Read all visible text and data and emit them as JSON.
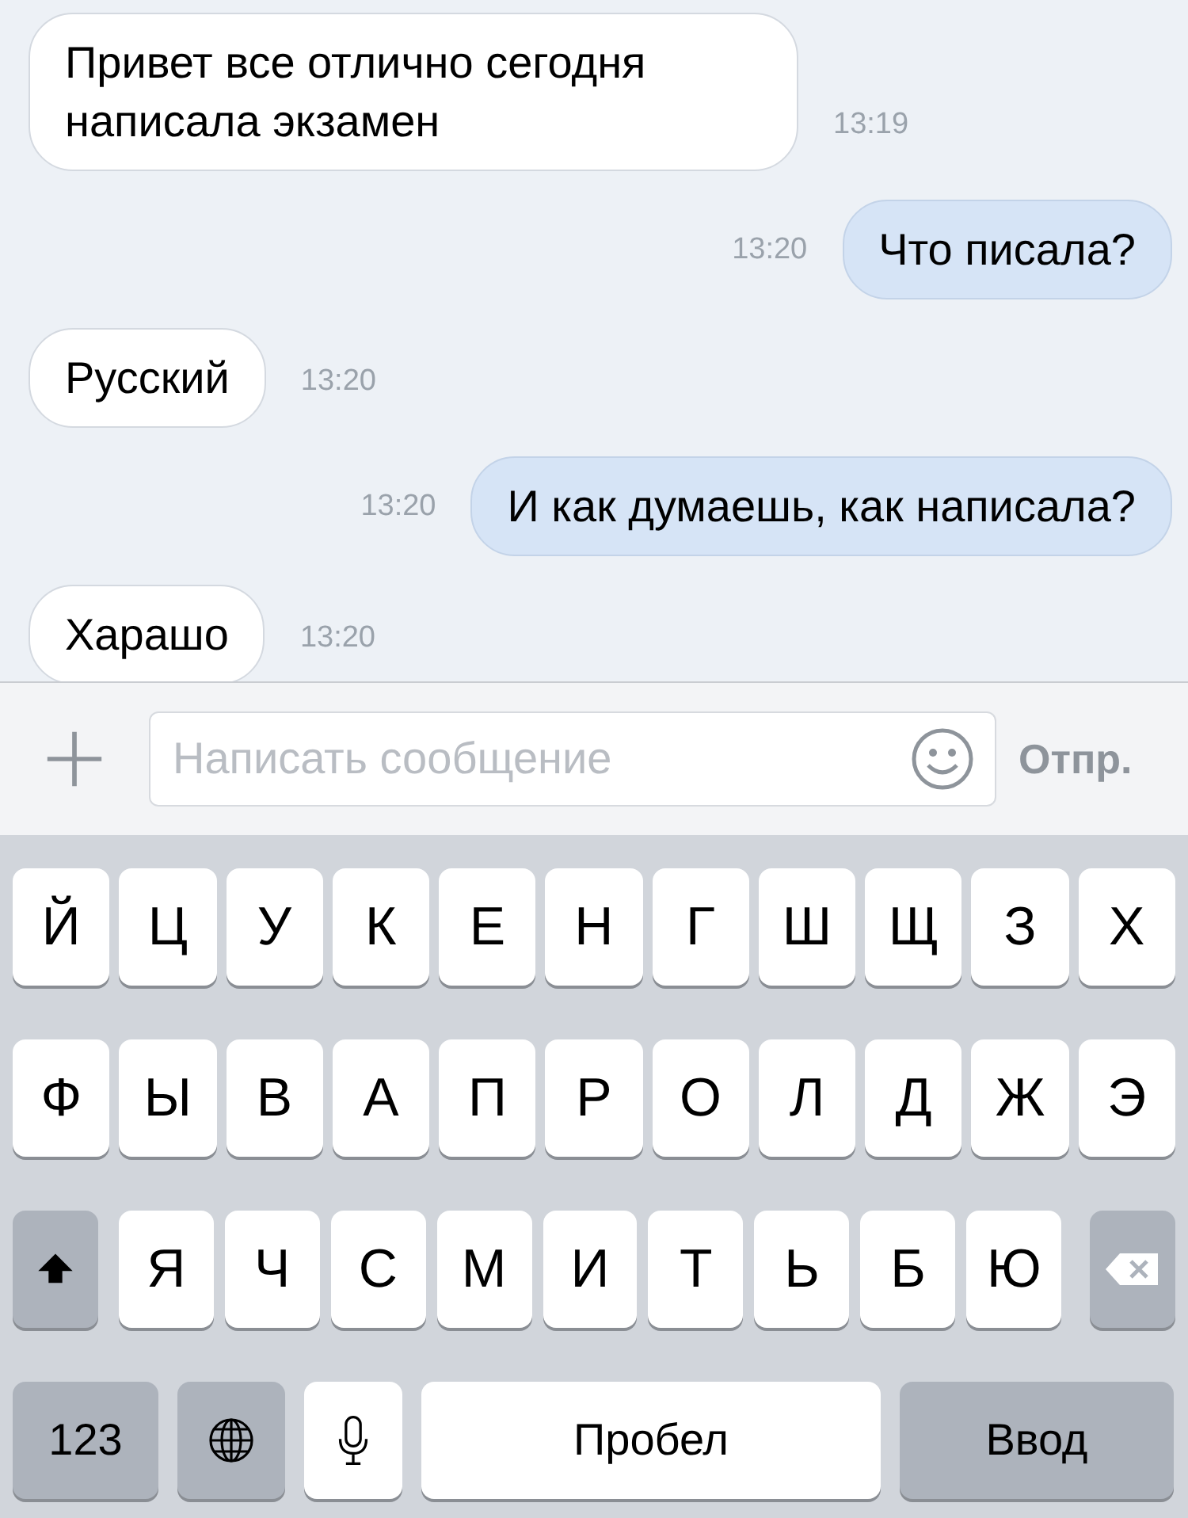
{
  "messages": [
    {
      "kind": "incoming",
      "text": "Привет все отлично сегодня написала экзамен",
      "time": "13:19"
    },
    {
      "kind": "outgoing",
      "text": "Что писала?",
      "time": "13:20"
    },
    {
      "kind": "incoming",
      "text": "Русский",
      "time": "13:20"
    },
    {
      "kind": "outgoing",
      "text": "И как думаешь, как написала?",
      "time": "13:20"
    },
    {
      "kind": "incoming",
      "text": "Харашо",
      "time": "13:20"
    }
  ],
  "composer": {
    "placeholder": "Написать сообщение",
    "send_label": "Отпр."
  },
  "keyboard": {
    "letter_rows": [
      [
        {
          "kind": "letter",
          "label": "Й"
        },
        {
          "kind": "letter",
          "label": "Ц"
        },
        {
          "kind": "letter",
          "label": "У"
        },
        {
          "kind": "letter",
          "label": "К"
        },
        {
          "kind": "letter",
          "label": "Е"
        },
        {
          "kind": "letter",
          "label": "Н"
        },
        {
          "kind": "letter",
          "label": "Г"
        },
        {
          "kind": "letter",
          "label": "Ш"
        },
        {
          "kind": "letter",
          "label": "Щ"
        },
        {
          "kind": "letter",
          "label": "З"
        },
        {
          "kind": "letter",
          "label": "Х"
        }
      ],
      [
        {
          "kind": "letter",
          "label": "Ф"
        },
        {
          "kind": "letter",
          "label": "Ы"
        },
        {
          "kind": "letter",
          "label": "В"
        },
        {
          "kind": "letter",
          "label": "А"
        },
        {
          "kind": "letter",
          "label": "П"
        },
        {
          "kind": "letter",
          "label": "Р"
        },
        {
          "kind": "letter",
          "label": "О"
        },
        {
          "kind": "letter",
          "label": "Л"
        },
        {
          "kind": "letter",
          "label": "Д"
        },
        {
          "kind": "letter",
          "label": "Ж"
        },
        {
          "kind": "letter",
          "label": "Э"
        }
      ],
      [
        {
          "kind": "shift"
        },
        {
          "kind": "letter",
          "label": "Я"
        },
        {
          "kind": "letter",
          "label": "Ч"
        },
        {
          "kind": "letter",
          "label": "С"
        },
        {
          "kind": "letter",
          "label": "М"
        },
        {
          "kind": "letter",
          "label": "И"
        },
        {
          "kind": "letter",
          "label": "Т"
        },
        {
          "kind": "letter",
          "label": "Ь"
        },
        {
          "kind": "letter",
          "label": "Б"
        },
        {
          "kind": "letter",
          "label": "Ю"
        },
        {
          "kind": "backspace"
        }
      ]
    ],
    "bottom_row": [
      {
        "kind": "numbers",
        "label": "123"
      },
      {
        "kind": "globe"
      },
      {
        "kind": "mic"
      },
      {
        "kind": "space",
        "label": "Пробел"
      },
      {
        "kind": "return",
        "label": "Ввод"
      }
    ]
  }
}
